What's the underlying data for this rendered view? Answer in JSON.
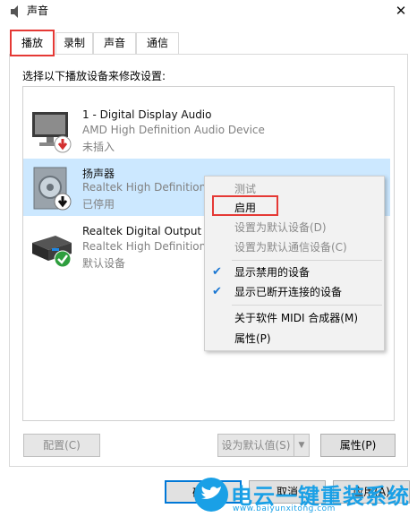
{
  "window": {
    "title": "声音",
    "close_glyph": "✕"
  },
  "tabs": [
    {
      "label": "播放",
      "selected": true
    },
    {
      "label": "录制"
    },
    {
      "label": "声音"
    },
    {
      "label": "通信"
    }
  ],
  "instruction": "选择以下播放设备来修改设置:",
  "devices": [
    {
      "name": "1 - Digital Display Audio",
      "description": "AMD High Definition Audio Device",
      "status": "未插入",
      "icon": "monitor-icon",
      "badge": "red-down-arrow-icon"
    },
    {
      "name": "扬声器",
      "description": "Realtek High Definition",
      "status": "已停用",
      "icon": "speaker-icon",
      "badge": "black-down-arrow-icon",
      "selected": true
    },
    {
      "name": "Realtek Digital Output",
      "description": "Realtek High Definition",
      "status": "默认设备",
      "icon": "digital-output-icon",
      "badge": "green-check-icon"
    }
  ],
  "context_menu": {
    "items": [
      {
        "label": "测试",
        "enabled": false
      },
      {
        "label": "启用",
        "enabled": true
      },
      {
        "label": "设置为默认设备(D)",
        "enabled": false
      },
      {
        "label": "设置为默认通信设备(C)",
        "enabled": false
      },
      {
        "label": "显示禁用的设备",
        "enabled": true,
        "checked": true
      },
      {
        "label": "显示已断开连接的设备",
        "enabled": true,
        "checked": true
      },
      {
        "label": "关于软件 MIDI 合成器(M)",
        "enabled": true
      },
      {
        "label": "属性(P)",
        "enabled": true
      }
    ]
  },
  "buttons": {
    "configure": "配置(C)",
    "set_default": "设为默认值(S)",
    "properties": "属性(P)",
    "ok": "确定",
    "cancel": "取消",
    "apply": "应用(A)"
  },
  "watermark": {
    "title": "电云一键重装系统",
    "url": "www.baiyunxitong.com"
  },
  "colors": {
    "selection": "#cce8ff",
    "highlight_box": "#e53935",
    "accent": "#0078d7",
    "watermark": "#1aa0e6"
  }
}
